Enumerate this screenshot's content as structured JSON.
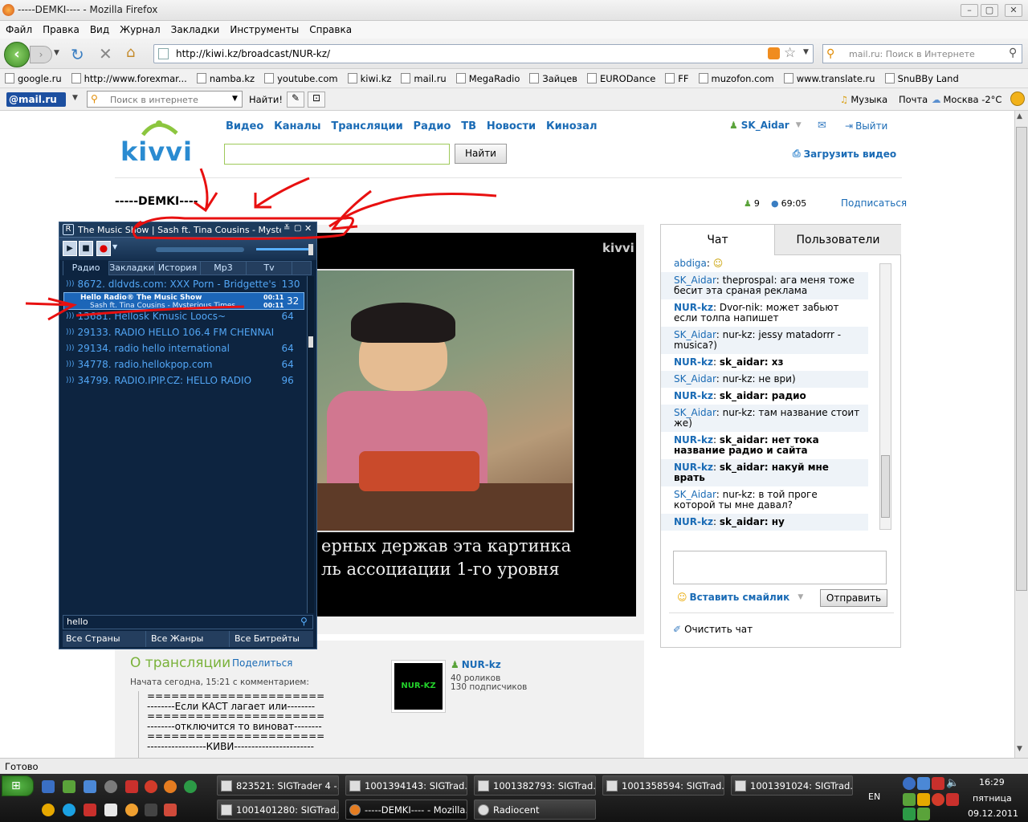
{
  "window": {
    "title": "-----DEMKI---- - Mozilla Firefox",
    "min": "–",
    "max": "▢",
    "close": "✕"
  },
  "menu": [
    "Файл",
    "Правка",
    "Вид",
    "Журнал",
    "Закладки",
    "Инструменты",
    "Справка"
  ],
  "nav": {
    "url": "http://kiwi.kz/broadcast/NUR-kz/",
    "search_placeholder": "mail.ru: Поиск в Интернете"
  },
  "bookmarks": [
    "google.ru",
    "http://www.forexmar...",
    "namba.kz",
    "youtube.com",
    "kiwi.kz",
    "mail.ru",
    "MegaRadio",
    "Зайцев",
    "EURODance",
    "FF",
    "muzofon.com",
    "www.translate.ru",
    "SnuBBy Land"
  ],
  "mailbar": {
    "logo": "@mail.ru",
    "search_placeholder": "Поиск в интернете",
    "find": "Найти!",
    "music": "Музыка",
    "mail": "Почта",
    "weather": "Москва -2°C"
  },
  "site": {
    "logo": "kivvi",
    "nav": [
      "Видео",
      "Каналы",
      "Трансляции",
      "Радио",
      "ТВ",
      "Новости",
      "Кинозал"
    ],
    "user": "SK_Aidar",
    "logout": "Выйти",
    "search_btn": "Найти",
    "upload": "Загрузить видео",
    "broadcast_title": "-----DEMKI----",
    "viewers": "9",
    "time": "69:05",
    "subscribe": "Подписаться",
    "video_watermark": "kivvi",
    "subtitle1": "ерных держав эта картинка",
    "subtitle2": "ль ассоциации 1-го уровня",
    "about_title": "О трансляции",
    "share": "Поделиться",
    "started": "Начата сегодна, 15:21 с комментарием:",
    "desc": [
      "======================",
      "--------Если КАСТ лагает или--------",
      "======================",
      "--------отключится то виноват--------",
      "======================",
      "-----------------КИВИ-----------------------"
    ],
    "channel": {
      "thumb": "NUR-KZ",
      "name": "NUR-kz",
      "videos": "40 роликов",
      "subs": "130 подписчиков"
    }
  },
  "chat": {
    "tab_chat": "Чат",
    "tab_users": "Пользователи",
    "messages": [
      {
        "who": "abdiga",
        "text": "",
        "bold": false
      },
      {
        "who": "SK_Aidar",
        "text": "theprospal: ага меня тоже бесит эта сраная реклама",
        "bold": false
      },
      {
        "who": "NUR-kz",
        "text": "Dvor-nik: может забьют если толпа напишет",
        "bold": false
      },
      {
        "who": "SK_Aidar",
        "text": "nur-kz: jessy matadorrr - musica?)",
        "bold": false
      },
      {
        "who": "NUR-kz",
        "text": "sk_aidar: хз",
        "bold": true
      },
      {
        "who": "SK_Aidar",
        "text": "nur-kz: не ври)",
        "bold": false
      },
      {
        "who": "NUR-kz",
        "text": "sk_aidar: радио",
        "bold": true
      },
      {
        "who": "SK_Aidar",
        "text": "nur-kz: там название стоит же)",
        "bold": false
      },
      {
        "who": "NUR-kz",
        "text": "sk_aidar: нет тока название радио и сайта",
        "bold": true
      },
      {
        "who": "NUR-kz",
        "text": "sk_aidar: накуй мне врать",
        "bold": true
      },
      {
        "who": "SK_Aidar",
        "text": "nur-kz: в той проге которой ты мне давал?",
        "bold": false
      },
      {
        "who": "NUR-kz",
        "text": "sk_aidar: ну",
        "bold": true
      }
    ],
    "smiley": "Вставить смайлик",
    "send": "Отправить",
    "clear": "Очистить чат"
  },
  "radio": {
    "title": "The Music Show | Sash ft. Tina Cousins - Mysterious T",
    "tabs": [
      "Радио",
      "Закладки",
      "История",
      "Mp3",
      "Tv"
    ],
    "stations": [
      {
        "name": "8672. dldvds.com: XXX Porn - Bridgette's Hell",
        "rate": "130"
      },
      {
        "name": "13681. Hellosk Kmusic Loocs~",
        "rate": "64"
      },
      {
        "name": "29133. RADIO HELLO 106.4 FM CHENNAI",
        "rate": ""
      },
      {
        "name": "29134. radio hello international",
        "rate": "64"
      },
      {
        "name": "34778. radio.hellokpop.com",
        "rate": "64"
      },
      {
        "name": "34799. RADIO.IPIP.CZ: HELLO RADIO",
        "rate": "96"
      }
    ],
    "tooltip": {
      "line1": "Hello Radio® The Music Show",
      "line2": "Sash ft. Tina Cousins - Mysterious Times",
      "t1": "00:11",
      "t2": "00:11",
      "rate": "32"
    },
    "search": "hello",
    "filters": [
      "Все Страны",
      "Все Жанры",
      "Все Битрейты"
    ]
  },
  "status": "Готово",
  "taskbar": {
    "row1": [
      "823521: SIGTrader 4 -...",
      "1001394143: SIGTrad...",
      "1001382793: SIGTrad...",
      "1001358594: SIGTrad...",
      "1001391024: SIGTrad..."
    ],
    "row2": [
      "1001401280: SIGTrad...",
      "-----DEMKI---- - Mozilla...",
      "Radiocent"
    ],
    "lang": "EN",
    "clock": "16:29",
    "day": "пятница",
    "date": "09.12.2011"
  }
}
